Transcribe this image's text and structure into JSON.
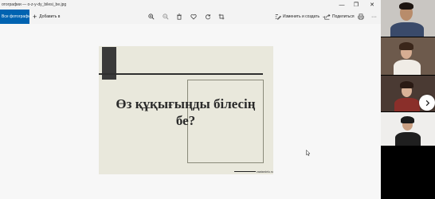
{
  "window": {
    "title": "отографии — о-z-у-dy_bilesi_be.jpg",
    "controls": [
      "—",
      "❐",
      "✕"
    ]
  },
  "toolbar": {
    "all_photos_label": "Все фотографии",
    "add_to_label": "Добавить в",
    "icons": [
      "zoom-in-icon",
      "zoom-out-icon",
      "delete-icon",
      "favorite-icon",
      "rotate-icon",
      "crop-icon"
    ],
    "edit_create_label": "Изменить и создать",
    "share_label": "Поделиться",
    "print_icon": "print-icon",
    "more_label": "···"
  },
  "slide": {
    "heading_line1": "Өз құқығыңды білесің",
    "heading_line2": "бе?",
    "footer_text": "zaatsedelu.ru"
  },
  "colors": {
    "accent": "#0063b1",
    "slide_bg": "#e9e8dc",
    "viewer_bg": "#f7f7f7"
  },
  "participants": {
    "count": 4,
    "next_icon": "chevron-right-icon"
  }
}
